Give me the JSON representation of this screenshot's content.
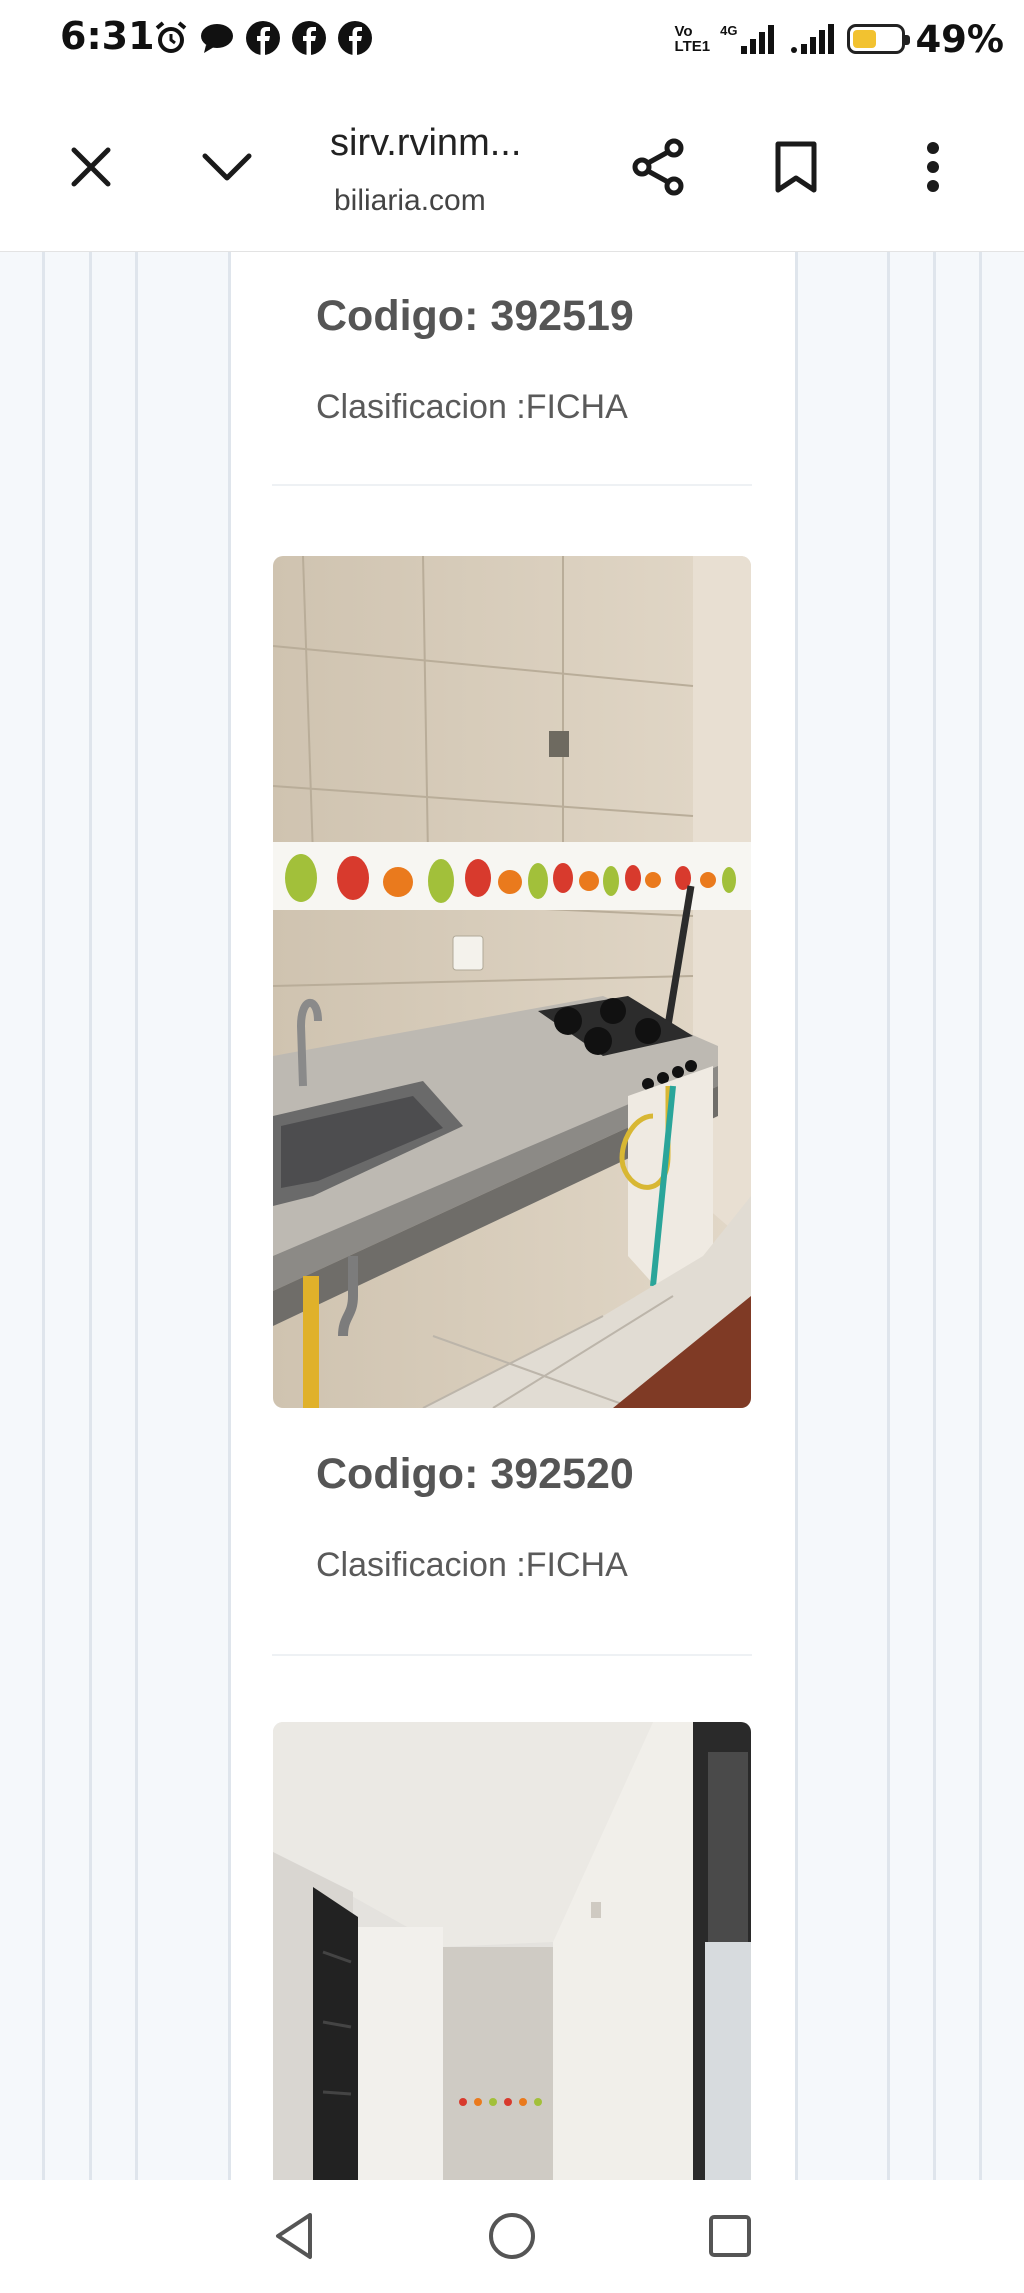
{
  "status_bar": {
    "time": "6:31",
    "left_icons": [
      "alarm-icon",
      "message-icon",
      "facebook-icon",
      "facebook-icon",
      "facebook-icon"
    ],
    "volte_top": "Vo",
    "volte_bottom": "LTE1",
    "network_type": "4G",
    "battery_percent": "49%",
    "battery_level": 0.49,
    "battery_color": "#f2c230"
  },
  "toolbar": {
    "url_title": "sirv.rvinm...",
    "url_subtitle": "biliaria.com",
    "icons": [
      "close-icon",
      "chevron-down-icon",
      "share-icon",
      "bookmark-icon",
      "more-vert-icon"
    ]
  },
  "listings": [
    {
      "codigo": "Codigo: 392519",
      "clasificacion": "Clasificacion :FICHA"
    },
    {
      "codigo": "Codigo: 392520",
      "clasificacion": "Clasificacion :FICHA"
    }
  ],
  "photos": [
    "kitchen-photo",
    "hallway-photo"
  ],
  "nav_bar": {
    "icons": [
      "back-icon",
      "home-icon",
      "recents-icon"
    ]
  }
}
